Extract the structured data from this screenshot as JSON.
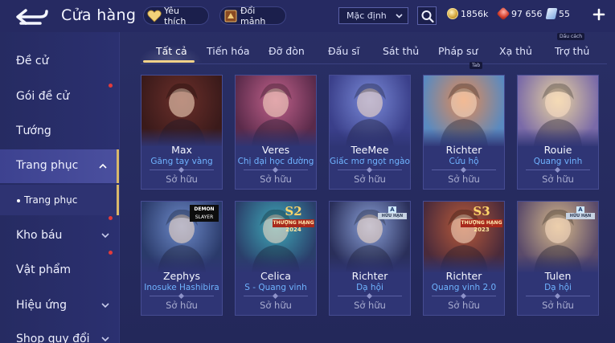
{
  "header": {
    "title": "Cửa hàng",
    "favorites_label": "Yêu thích",
    "fragments_label": "Đổi mảnh",
    "sort_value": "Mặc định",
    "gold": "1856k",
    "ruby": "97 656",
    "voucher": "55",
    "hint_space": "Dấu cách",
    "hint_tab": "Tab",
    "colors": {
      "accent": "#f1d28a",
      "background": "#262b5e",
      "notification": "#e23b3b",
      "skin_text": "#6fb3ff"
    }
  },
  "sidebar": {
    "items": [
      {
        "label": "Đề cử"
      },
      {
        "label": "Gói đề cử"
      },
      {
        "label": "Tướng"
      },
      {
        "label": "Trang phục"
      },
      {
        "label": "Kho báu"
      },
      {
        "label": "Vật phẩm"
      },
      {
        "label": "Hiệu ứng"
      },
      {
        "label": "Shop quy đổi"
      }
    ],
    "sub_item": "Trang phục"
  },
  "tabs": [
    "Tất cả",
    "Tiến hóa",
    "Đỡ đòn",
    "Đấu sĩ",
    "Sát thủ",
    "Pháp sư",
    "Xạ thủ",
    "Trợ thủ"
  ],
  "cards": [
    {
      "name": "Max",
      "skin": "Găng tay vàng",
      "status": "Sở hữu",
      "palette": [
        "#6b2f2a",
        "#3a1a1a"
      ]
    },
    {
      "name": "Veres",
      "skin": "Chị đại học đường",
      "status": "Sở hữu",
      "palette": [
        "#c0618a",
        "#5a2a4a"
      ]
    },
    {
      "name": "TeeMee",
      "skin": "Giấc mơ ngọt ngào",
      "status": "Sở hữu",
      "palette": [
        "#7a8ad8",
        "#3a3f8a"
      ]
    },
    {
      "name": "Richter",
      "skin": "Cứu hộ",
      "status": "Sở hữu",
      "palette": [
        "#e38a55",
        "#5a8ac0"
      ]
    },
    {
      "name": "Rouie",
      "skin": "Quang vinh",
      "status": "Sở hữu",
      "palette": [
        "#e9d3a0",
        "#7a6aa8"
      ]
    },
    {
      "name": "Zephys",
      "skin": "Inosuke Hashibira",
      "status": "Sở hữu",
      "palette": [
        "#6d8ac9",
        "#2a3a6a"
      ],
      "tag": {
        "top": "DEMON",
        "bottom": "SLAYER"
      }
    },
    {
      "name": "Celica",
      "skin": "S - Quang vinh",
      "status": "Sở hữu",
      "palette": [
        "#3fa8b8",
        "#2a3f6a"
      ],
      "rank": {
        "season": "S2",
        "label": "THƯỢNG HẠNG",
        "year": "2024"
      }
    },
    {
      "name": "Richter",
      "skin": "Dạ hội",
      "status": "Sở hữu",
      "palette": [
        "#8aa0d8",
        "#2a2f5a"
      ],
      "limited": {
        "grade": "A",
        "label": "HỮU HẠN"
      }
    },
    {
      "name": "Richter",
      "skin": "Quang vinh 2.0",
      "status": "Sở hữu",
      "palette": [
        "#b85a3a",
        "#4a2a3a"
      ],
      "rank": {
        "season": "S3",
        "label": "THƯỢNG HẠNG",
        "year": "2023"
      }
    },
    {
      "name": "Tulen",
      "skin": "Dạ hội",
      "status": "Sở hữu",
      "palette": [
        "#d6b88a",
        "#5a4a6a"
      ],
      "limited": {
        "grade": "A",
        "label": "HỮU HẠN"
      }
    }
  ]
}
